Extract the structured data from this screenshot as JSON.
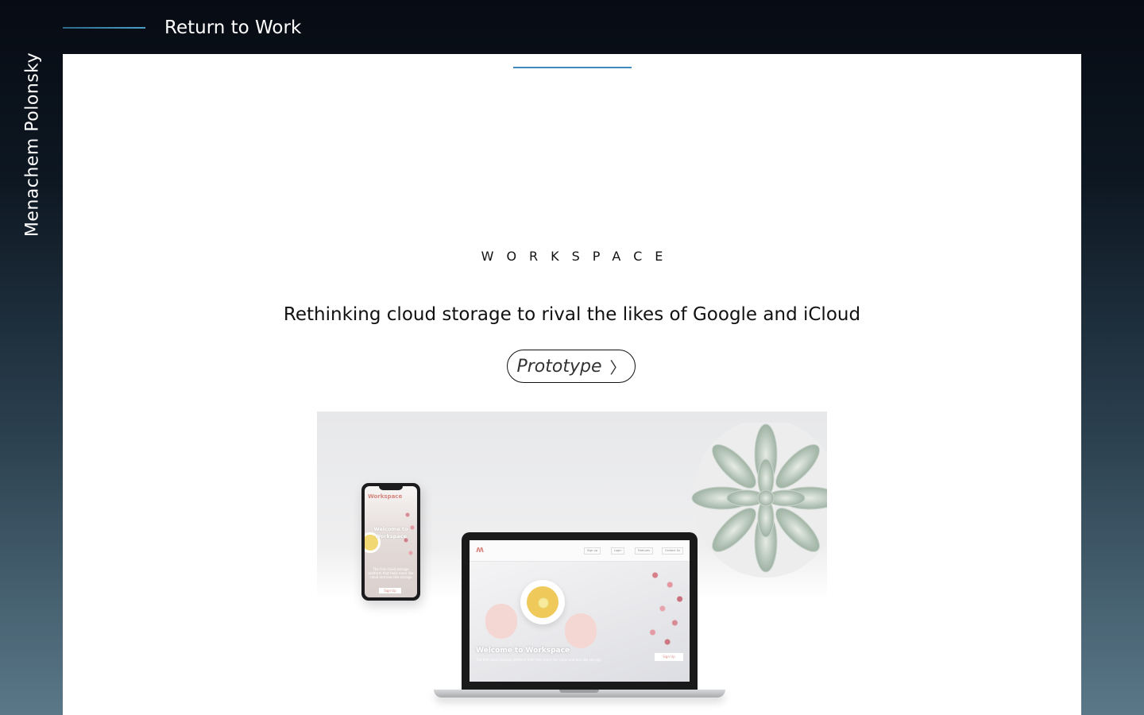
{
  "sidebar": {
    "name": "Menachem Polonsky"
  },
  "header": {
    "return_label": "Return to Work"
  },
  "project": {
    "eyebrow": "WORKSPACE",
    "headline": "Rethinking cloud storage to rival the likes of Google and iCloud",
    "prototype_label": "Prototype"
  },
  "mockup": {
    "phone": {
      "title": "Workspace",
      "welcome": "Welcome to Workspace",
      "body": "The first cloud storage platform that feels more like cloud and less like storage",
      "button": "Sign Up"
    },
    "laptop": {
      "nav": [
        "Sign up",
        "Login",
        "Features",
        "Contact Us"
      ],
      "hero_title": "Welcome to Workspace",
      "hero_sub": "The first cloud storage platform that feels more like cloud and less like storage",
      "cta": "Sign Up"
    }
  },
  "colors": {
    "accent": "#3d8bc0",
    "brand_pink": "#d98c83",
    "panel": "#ffffff"
  },
  "icons": {
    "prototype_chevron": "chevron-right-icon"
  }
}
